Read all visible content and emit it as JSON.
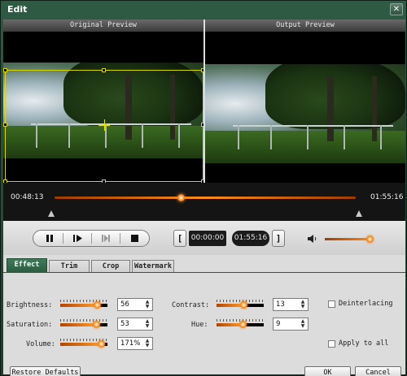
{
  "window": {
    "title": "Edit",
    "close_glyph": "✕"
  },
  "previews": {
    "original_label": "Original Preview",
    "output_label": "Output Preview"
  },
  "timeline": {
    "current_time": "00:48:13",
    "total_time": "01:55:16",
    "progress_fraction": 0.42
  },
  "playback": {
    "buttons": [
      "pause-icon",
      "play-frame-icon",
      "next-frame-icon",
      "stop-icon"
    ]
  },
  "range": {
    "start_bracket": "[",
    "end_bracket": "]",
    "start_time": "00:00:00",
    "end_time": "01:55:16"
  },
  "volume": {
    "icon": "speaker-icon",
    "level_fraction": 0.95
  },
  "tabs": [
    {
      "label": "Effect",
      "active": true
    },
    {
      "label": "Trim",
      "active": false
    },
    {
      "label": "Crop",
      "active": false
    },
    {
      "label": "Watermark",
      "active": false
    }
  ],
  "effect": {
    "brightness": {
      "label": "Brightness:",
      "value": "56",
      "fraction": 0.78
    },
    "saturation": {
      "label": "Saturation:",
      "value": "53",
      "fraction": 0.76
    },
    "volume": {
      "label": "Volume:",
      "value": "171%",
      "fraction": 0.86
    },
    "contrast": {
      "label": "Contrast:",
      "value": "13",
      "fraction": 0.57
    },
    "hue": {
      "label": "Hue:",
      "value": "9",
      "fraction": 0.55
    },
    "deinterlacing": {
      "label": "Deinterlacing",
      "checked": false
    },
    "apply_to_all": {
      "label": "Apply to all",
      "checked": false
    }
  },
  "footer": {
    "restore_label": "Restore Defaults",
    "ok_label": "OK",
    "cancel_label": "Cancel"
  },
  "colors": {
    "accent": "#ff8c1a",
    "frame": "#2c5a41",
    "crop_box": "#d8d800"
  }
}
